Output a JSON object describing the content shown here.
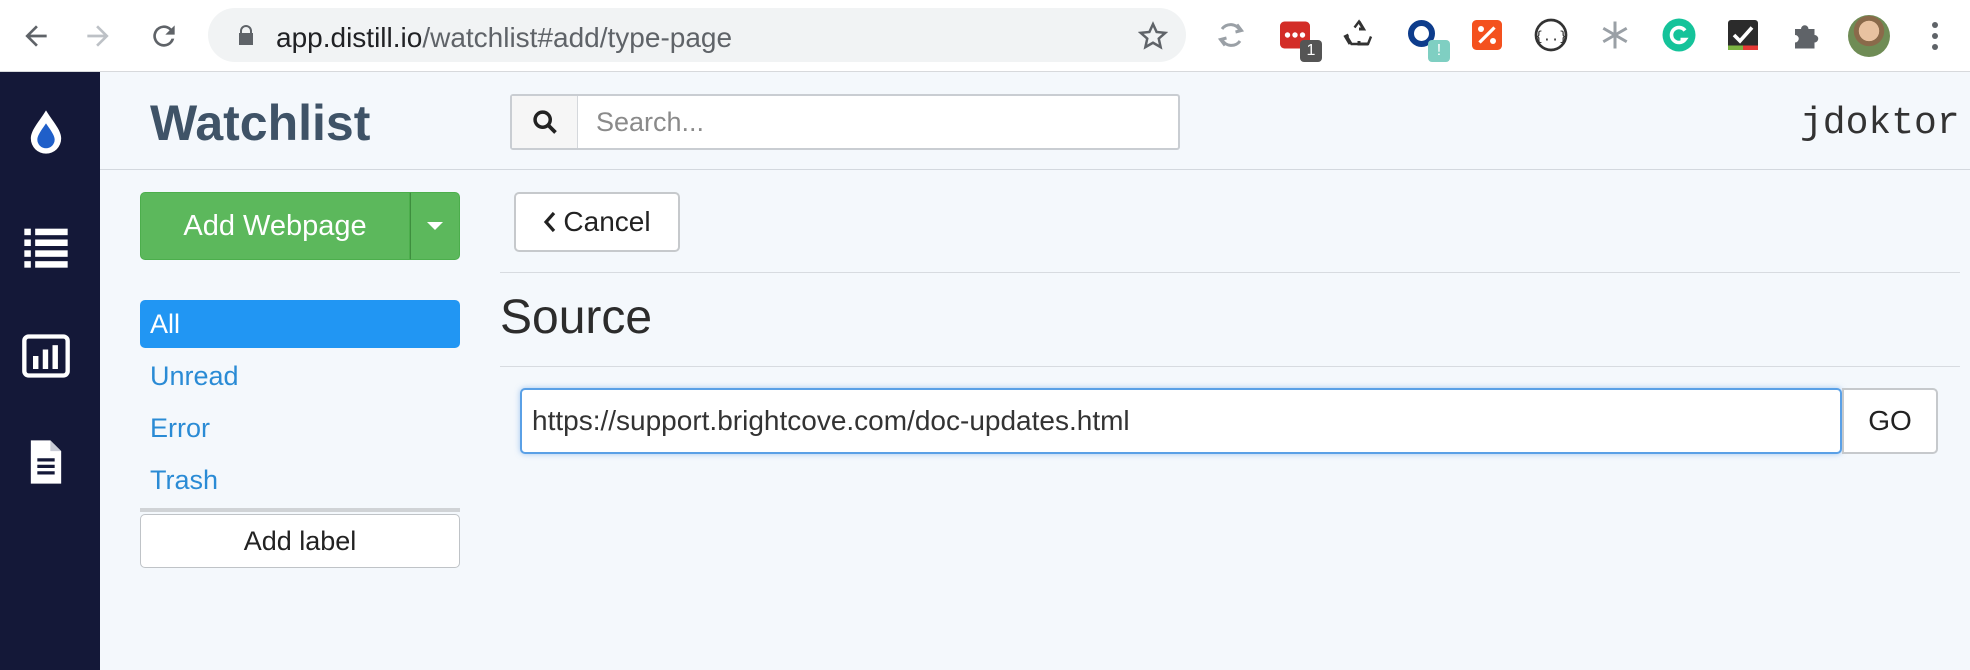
{
  "browser": {
    "url_host": "app.distill.io",
    "url_path": "/watchlist#add/type-page",
    "extensions": [
      {
        "name": "sync-ext-icon"
      },
      {
        "name": "lastpass-ext-icon",
        "badge": "1",
        "badge_color": "#555555"
      },
      {
        "name": "recycle-ext-icon"
      },
      {
        "name": "blue-ring-ext-icon",
        "badge": "!",
        "badge_color": "#7fcfc2"
      },
      {
        "name": "orange-percent-ext-icon"
      },
      {
        "name": "json-ext-icon"
      },
      {
        "name": "snowflake-ext-icon"
      },
      {
        "name": "grammarly-ext-icon"
      },
      {
        "name": "checklist-ext-icon"
      },
      {
        "name": "puzzle-ext-icon"
      }
    ]
  },
  "sidebar": {
    "icons": [
      "drop-logo-icon",
      "list-icon",
      "bar-chart-icon",
      "document-icon"
    ]
  },
  "header": {
    "title": "Watchlist",
    "search_placeholder": "Search...",
    "username": "jdoktor"
  },
  "left_panel": {
    "add_button": "Add Webpage",
    "labels": [
      "All",
      "Unread",
      "Error",
      "Trash"
    ],
    "active_label": "All",
    "add_label_button": "Add label"
  },
  "main": {
    "cancel_label": "Cancel",
    "section_title": "Source",
    "url_value": "https://support.brightcove.com/doc-updates.html",
    "go_label": "GO"
  },
  "colors": {
    "sidebar_bg": "#141838",
    "add_button": "#5cb85c",
    "active_label": "#2196f3",
    "link": "#2a8bd5"
  }
}
